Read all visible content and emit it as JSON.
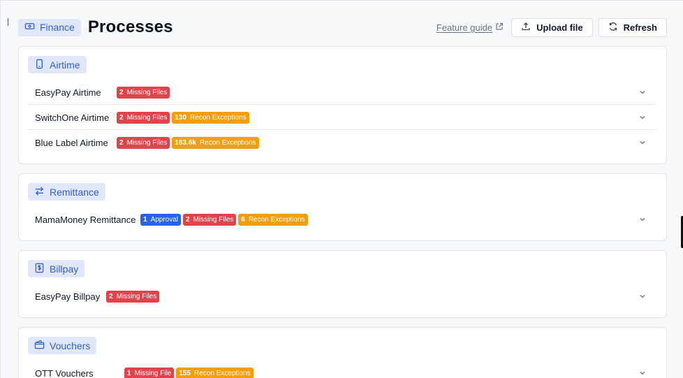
{
  "header": {
    "module_label": "Finance",
    "title": "Processes",
    "feature_guide_label": "Feature guide",
    "upload_label": "Upload file",
    "refresh_label": "Refresh"
  },
  "sections": [
    {
      "label": "Airtime",
      "icon": "phone-icon",
      "rows": [
        {
          "name": "EasyPay Airtime",
          "badges": [
            {
              "count": "2",
              "text": "Missing Files",
              "color": "#e2434b"
            }
          ]
        },
        {
          "name": "SwitchOne Airtime",
          "badges": [
            {
              "count": "2",
              "text": "Missing Files",
              "color": "#e2434b"
            },
            {
              "count": "130",
              "text": "Recon Exceptions",
              "color": "#f59e0b"
            }
          ]
        },
        {
          "name": "Blue Label Airtime",
          "badges": [
            {
              "count": "2",
              "text": "Missing Files",
              "color": "#e2434b"
            },
            {
              "count": "183.6k",
              "text": "Recon Exceptions",
              "color": "#f59e0b"
            }
          ]
        }
      ]
    },
    {
      "label": "Remittance",
      "icon": "transfer-arrows-icon",
      "rows": [
        {
          "name": "MamaMoney Remittance",
          "badges": [
            {
              "count": "1",
              "text": "Approval",
              "color": "#2563eb"
            },
            {
              "count": "2",
              "text": "Missing Files",
              "color": "#e2434b"
            },
            {
              "count": "6",
              "text": "Recon Exceptions",
              "color": "#f59e0b"
            }
          ]
        }
      ]
    },
    {
      "label": "Billpay",
      "icon": "dollar-receipt-icon",
      "rows": [
        {
          "name": "EasyPay Billpay",
          "badges": [
            {
              "count": "2",
              "text": "Missing Files",
              "color": "#e2434b"
            }
          ]
        }
      ]
    },
    {
      "label": "Vouchers",
      "icon": "wallet-icon",
      "rows": [
        {
          "name": "OTT Vouchers",
          "badges": [
            {
              "count": "1",
              "text": "Missing File",
              "color": "#e2434b"
            },
            {
              "count": "155",
              "text": "Recon Exceptions",
              "color": "#f59e0b"
            }
          ]
        }
      ]
    }
  ]
}
